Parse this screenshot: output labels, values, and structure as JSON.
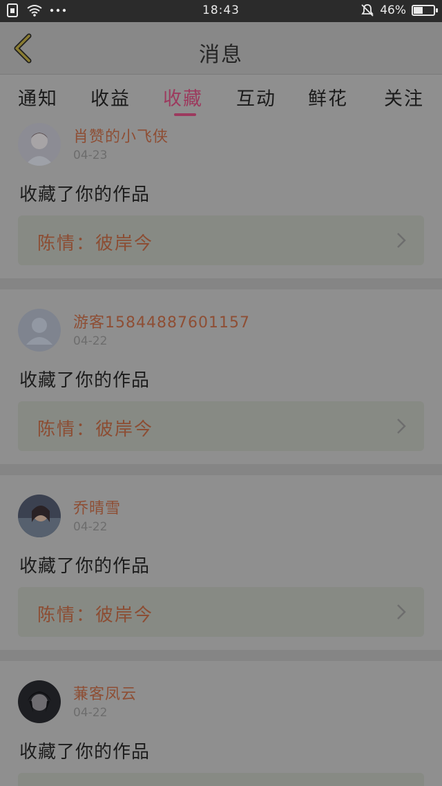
{
  "status_bar": {
    "time": "18:43",
    "battery": "46%",
    "battery_level": 0.46,
    "icons": [
      "sim-icon",
      "wifi-icon",
      "more-dots-icon",
      "bell-muted-icon",
      "battery-icon"
    ]
  },
  "navbar": {
    "title": "消息",
    "back_icon": "chevron-left-icon"
  },
  "tabs": [
    {
      "label": "通知",
      "active": false
    },
    {
      "label": "收益",
      "active": false
    },
    {
      "label": "收藏",
      "active": true
    },
    {
      "label": "互动",
      "active": false
    },
    {
      "label": "鲜花",
      "active": false
    },
    {
      "label": "关注",
      "active": false
    }
  ],
  "items": [
    {
      "user": "肖赞的小飞侠",
      "date": "04-23",
      "action": "收藏了你的作品",
      "work": "陈情：彼岸今"
    },
    {
      "user": "游客15844887601157",
      "date": "04-22",
      "action": "收藏了你的作品",
      "work": "陈情：彼岸今"
    },
    {
      "user": "乔晴雪",
      "date": "04-22",
      "action": "收藏了你的作品",
      "work": "陈情：彼岸今"
    },
    {
      "user": "蒹客凤云",
      "date": "04-22",
      "action": "收藏了你的作品",
      "work": ""
    }
  ],
  "colors": {
    "accent": "#9c3a5e",
    "username": "#8e4e34",
    "overlay_bg": "#8f8f8f"
  }
}
